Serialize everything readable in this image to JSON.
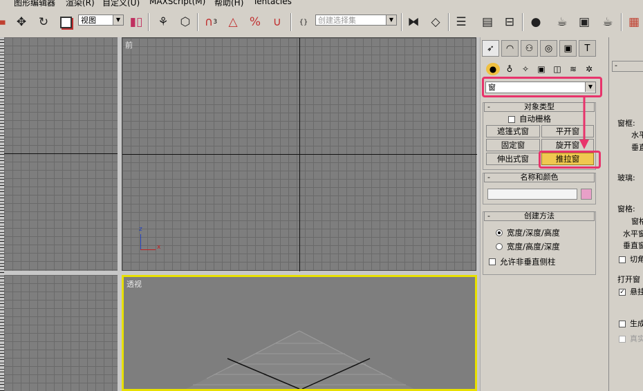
{
  "menu": [
    "图形编辑器",
    "渲染(R)",
    "自定义(U)",
    "MAXScript(M)",
    "帮助(H)",
    "Tentacles"
  ],
  "toolbar": {
    "view_dropdown": "视图",
    "selection_set_placeholder": "创建选择集",
    "snap_label": "3"
  },
  "viewports": {
    "front": "前",
    "perspective": "透视",
    "axis_x": "x",
    "axis_z": "z"
  },
  "command_panel": {
    "category_dropdown": "窗",
    "object_type": {
      "title": "对象类型",
      "autogrid": "自动栅格",
      "buttons": [
        "遮篷式窗",
        "平开窗",
        "固定窗",
        "旋开窗",
        "伸出式窗",
        "推拉窗"
      ],
      "selected": "推拉窗"
    },
    "name_color": {
      "title": "名称和颜色",
      "swatch_color": "#e8a0c8"
    },
    "creation_method": {
      "title": "创建方法",
      "option1": "宽度/深度/高度",
      "option2": "宽度/高度/深度",
      "allow_nonvertical": "允许非垂直侧柱"
    }
  },
  "right_panel": {
    "labels": [
      "窗框:",
      "水平",
      "垂直",
      "玻璃:",
      "窗格:",
      "窗格",
      "水平窗",
      "垂直窗",
      "切角",
      "打开窗",
      "悬挂",
      "生成",
      "真实"
    ]
  },
  "colors": {
    "highlight": "#e8336b",
    "selected_button": "#f0c850",
    "active_viewport": "#e8e000"
  }
}
